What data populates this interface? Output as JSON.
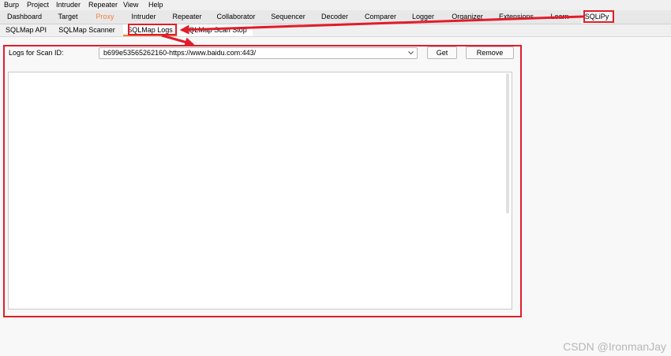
{
  "menu": [
    "Burp",
    "Project",
    "Intruder",
    "Repeater",
    "View",
    "Help"
  ],
  "tabs": [
    "Dashboard",
    "Target",
    "Proxy",
    "Intruder",
    "Repeater",
    "Collaborator",
    "Sequencer",
    "Decoder",
    "Comparer",
    "Logger",
    "Organizer",
    "Extensions",
    "Learn",
    "SQLiPy"
  ],
  "subtabs": [
    "SQLMap API",
    "SQLMap Scanner",
    "SQLMap Logs",
    "SQLMap Scan Stop"
  ],
  "logs": {
    "label": "Logs for Scan ID:",
    "scan_id": "b699e53565262160-https://www.baidu.com:443/",
    "get_label": "Get",
    "remove_label": "Remove"
  },
  "watermark": "CSDN @IronmanJay",
  "colors": {
    "accent": "#f0803c",
    "highlight": "#e21c2a"
  },
  "icons": {
    "dropdown": "chevron-down-icon"
  }
}
